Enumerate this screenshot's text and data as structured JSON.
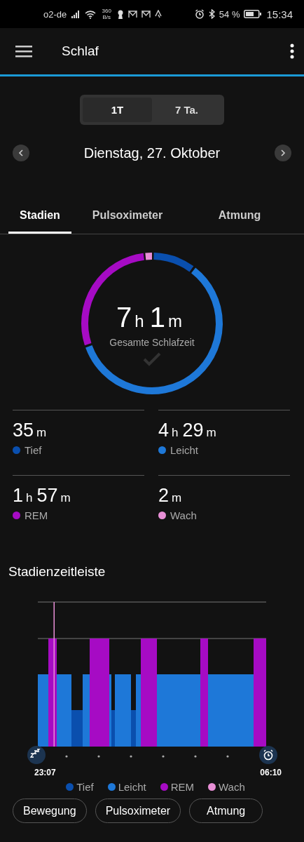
{
  "status_bar": {
    "carrier": "o2-de",
    "network_speed": "360 B/s",
    "battery": "54 %",
    "time": "15:34"
  },
  "app_bar": {
    "title": "Schlaf"
  },
  "range_toggle": [
    {
      "label": "1T",
      "selected": true
    },
    {
      "label": "7 Ta.",
      "selected": false
    }
  ],
  "date": "Dienstag, 27. Oktober",
  "tabs": [
    {
      "label": "Stadien",
      "selected": true
    },
    {
      "label": "Pulsoximeter",
      "selected": false
    },
    {
      "label": "Atmung",
      "selected": false
    }
  ],
  "summary": {
    "total": [
      {
        "number": "7",
        "unit": "h"
      },
      {
        "number": "1",
        "unit": "m"
      }
    ],
    "label": "Gesamte Schlafzeit"
  },
  "stats": [
    {
      "value": [
        {
          "number": "35",
          "unit": "m"
        }
      ],
      "label": "Tief",
      "color": "#0a4fae"
    },
    {
      "value": [
        {
          "number": "4",
          "unit": "h"
        },
        {
          "number": "29",
          "unit": "m"
        }
      ],
      "label": "Leicht",
      "color": "#1e78d8"
    },
    {
      "value": [
        {
          "number": "1",
          "unit": "h"
        },
        {
          "number": "57",
          "unit": "m"
        }
      ],
      "label": "REM",
      "color": "#a60bc4"
    },
    {
      "value": [
        {
          "number": "2",
          "unit": "m"
        }
      ],
      "label": "Wach",
      "color": "#e88fd6"
    }
  ],
  "timeline": {
    "title": "Stadienzeitleiste",
    "start_time": "23:07",
    "end_time": "06:10",
    "legend": [
      {
        "label": "Tief",
        "color": "#0a4fae"
      },
      {
        "label": "Leicht",
        "color": "#1e78d8"
      },
      {
        "label": "REM",
        "color": "#a60bc4"
      },
      {
        "label": "Wach",
        "color": "#e88fd6"
      }
    ]
  },
  "buttons": [
    "Bewegung",
    "Pulsoximeter",
    "Atmung"
  ]
}
